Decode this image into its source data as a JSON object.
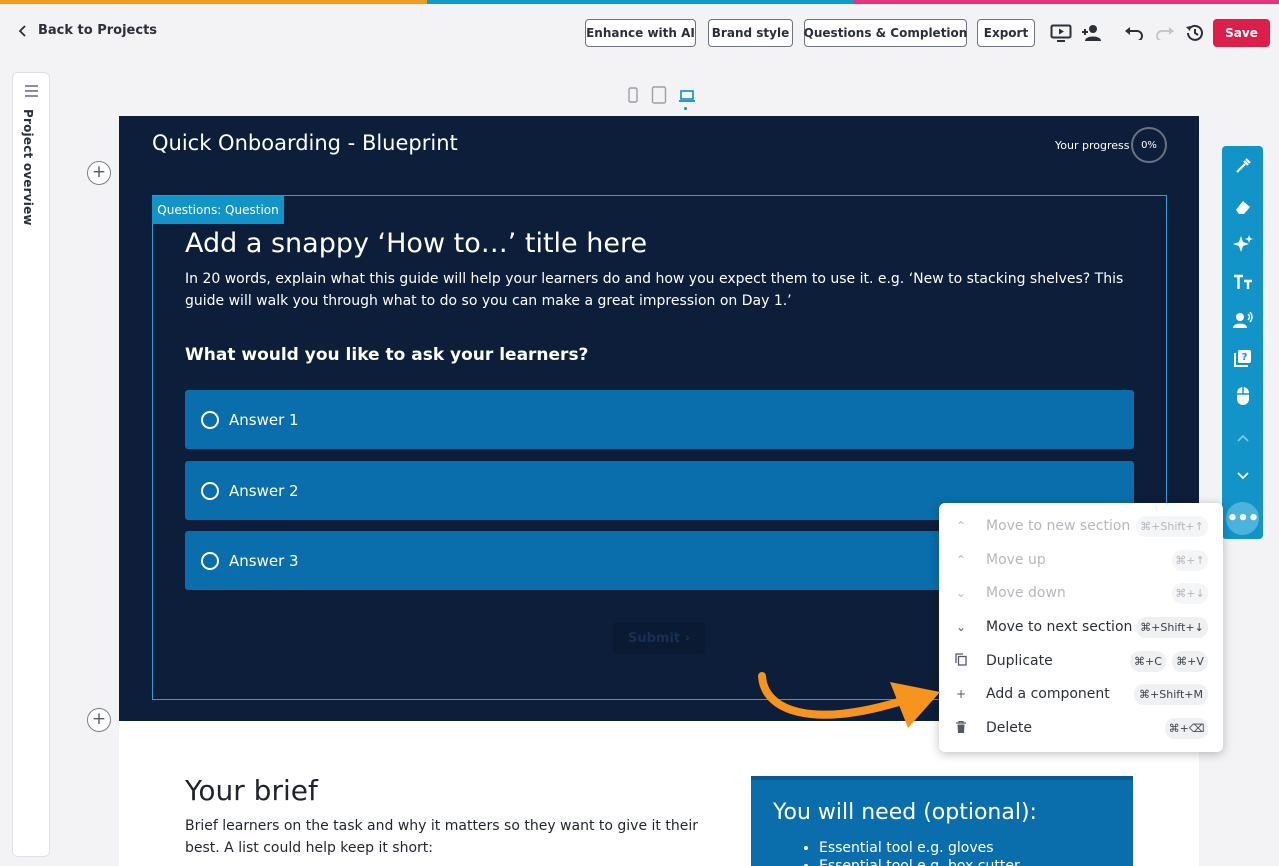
{
  "top_stripe_colors": [
    "#f29b1d",
    "#0f9bc9",
    "#e5347a"
  ],
  "header": {
    "back_label": "Back to Projects",
    "buttons": {
      "enhance": "Enhance with AI",
      "brand": "Brand style",
      "questions": "Questions & Completion",
      "export": "Export"
    },
    "icons": [
      "present-icon",
      "add-user-icon",
      "undo-icon",
      "redo-icon",
      "history-icon"
    ],
    "save_label": "Save",
    "save_color": "#dc1e4b"
  },
  "sidebar": {
    "label": "Project overview"
  },
  "devices": [
    "phone-icon",
    "tablet-icon",
    "laptop-icon"
  ],
  "stage": {
    "title": "Quick Onboarding - Blueprint",
    "progress_label": "Your progress",
    "progress_value": "0%",
    "question": {
      "tag": "Questions: Question",
      "title": "Add a snappy ‘How to…’ title here",
      "description": "In 20 words, explain what this guide will help your learners do and how you expect them to use it. e.g. ‘New to stacking shelves? This guide will walk you through what to do so you can make a great impression on Day 1.’",
      "ask": "What would you like to ask your learners?",
      "answers": [
        "Answer 1",
        "Answer 2",
        "Answer 3"
      ],
      "submit_label": "Submit"
    }
  },
  "lower": {
    "brief_title": "Your brief",
    "brief_text": "Brief learners on the task and why it matters so they want to give it their best. A list could help keep it short:",
    "need_title": "You will need (optional):",
    "need_items": [
      "Essential tool e.g. gloves",
      "Essential tool e.g. box cutter"
    ]
  },
  "right_toolbar": [
    "pipette-icon",
    "eraser-icon",
    "sparkles-icon",
    "text-size-icon",
    "voice-icon",
    "quiz-icon",
    "mouse-icon",
    "chevron-up-icon",
    "chevron-down-icon",
    "more-icon"
  ],
  "context_menu": {
    "items": [
      {
        "label": "Move to new section",
        "shortcuts": [
          "⌘+Shift+↑"
        ],
        "enabled": false
      },
      {
        "label": "Move up",
        "shortcuts": [
          "⌘+↑"
        ],
        "enabled": false
      },
      {
        "label": "Move down",
        "shortcuts": [
          "⌘+↓"
        ],
        "enabled": false
      },
      {
        "label": "Move to next section",
        "shortcuts": [
          "⌘+Shift+↓"
        ],
        "enabled": true
      },
      {
        "label": "Duplicate",
        "shortcuts": [
          "⌘+C",
          "⌘+V"
        ],
        "enabled": true
      },
      {
        "label": "Add a component",
        "shortcuts": [
          "⌘+Shift+M"
        ],
        "enabled": true
      },
      {
        "label": "Delete",
        "shortcuts": [
          "⌘+⌫"
        ],
        "enabled": true
      }
    ]
  },
  "accent_colors": {
    "primary": "#1294c8",
    "stage": "#0d1e3a",
    "answer": "#0a6eac",
    "arrow": "#f7941d"
  }
}
